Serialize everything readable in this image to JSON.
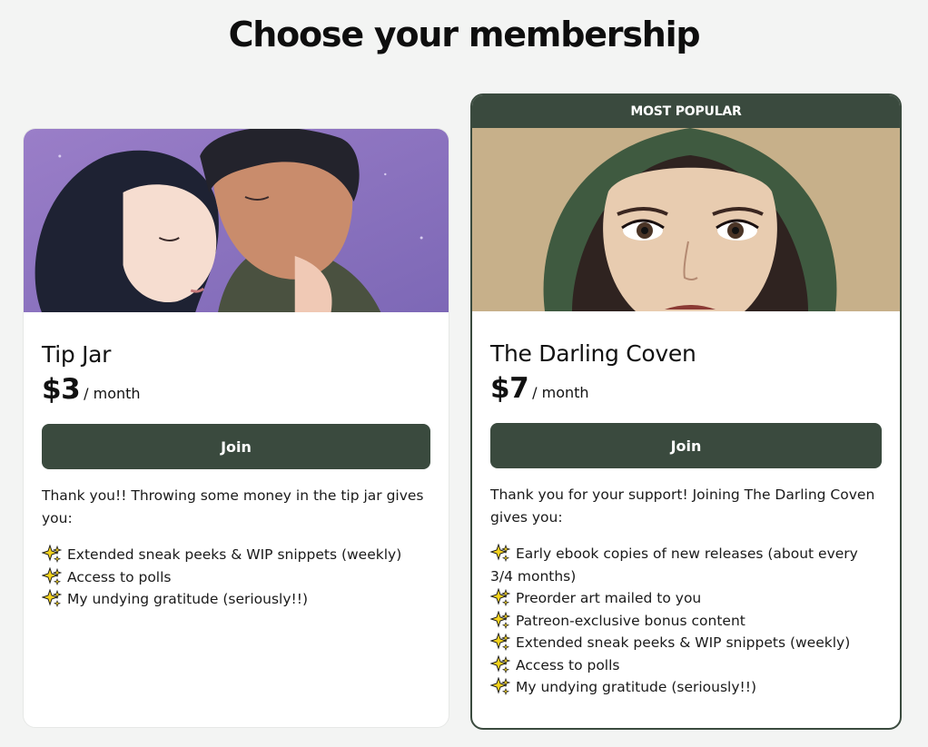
{
  "page": {
    "title": "Choose your membership"
  },
  "tiers": [
    {
      "name": "Tip Jar",
      "price": "$3",
      "period": "/ month",
      "button_label": "Join",
      "description": "Thank you!! Throwing some money in the tip jar gives you:",
      "benefit_icon": "sparkles-emoji",
      "benefits": [
        "Extended sneak peeks & WIP snippets (weekly)",
        "Access to polls",
        "My undying gratitude (seriously!!)"
      ]
    },
    {
      "name": "The Darling Coven",
      "badge": "MOST POPULAR",
      "price": "$7",
      "period": "/ month",
      "button_label": "Join",
      "description": "Thank you for your support! Joining The Darling Coven gives you:",
      "benefit_icon": "sparkles-emoji",
      "benefits": [
        "Early ebook copies of new releases (about every 3/4 months)",
        "Preorder art mailed to you",
        "Patreon-exclusive bonus content",
        "Extended sneak peeks & WIP snippets (weekly)",
        "Access to polls",
        "My undying gratitude (seriously!!)"
      ]
    }
  ],
  "colors": {
    "accent": "#3a4a3e",
    "background": "#f3f4f3",
    "card": "#ffffff"
  }
}
